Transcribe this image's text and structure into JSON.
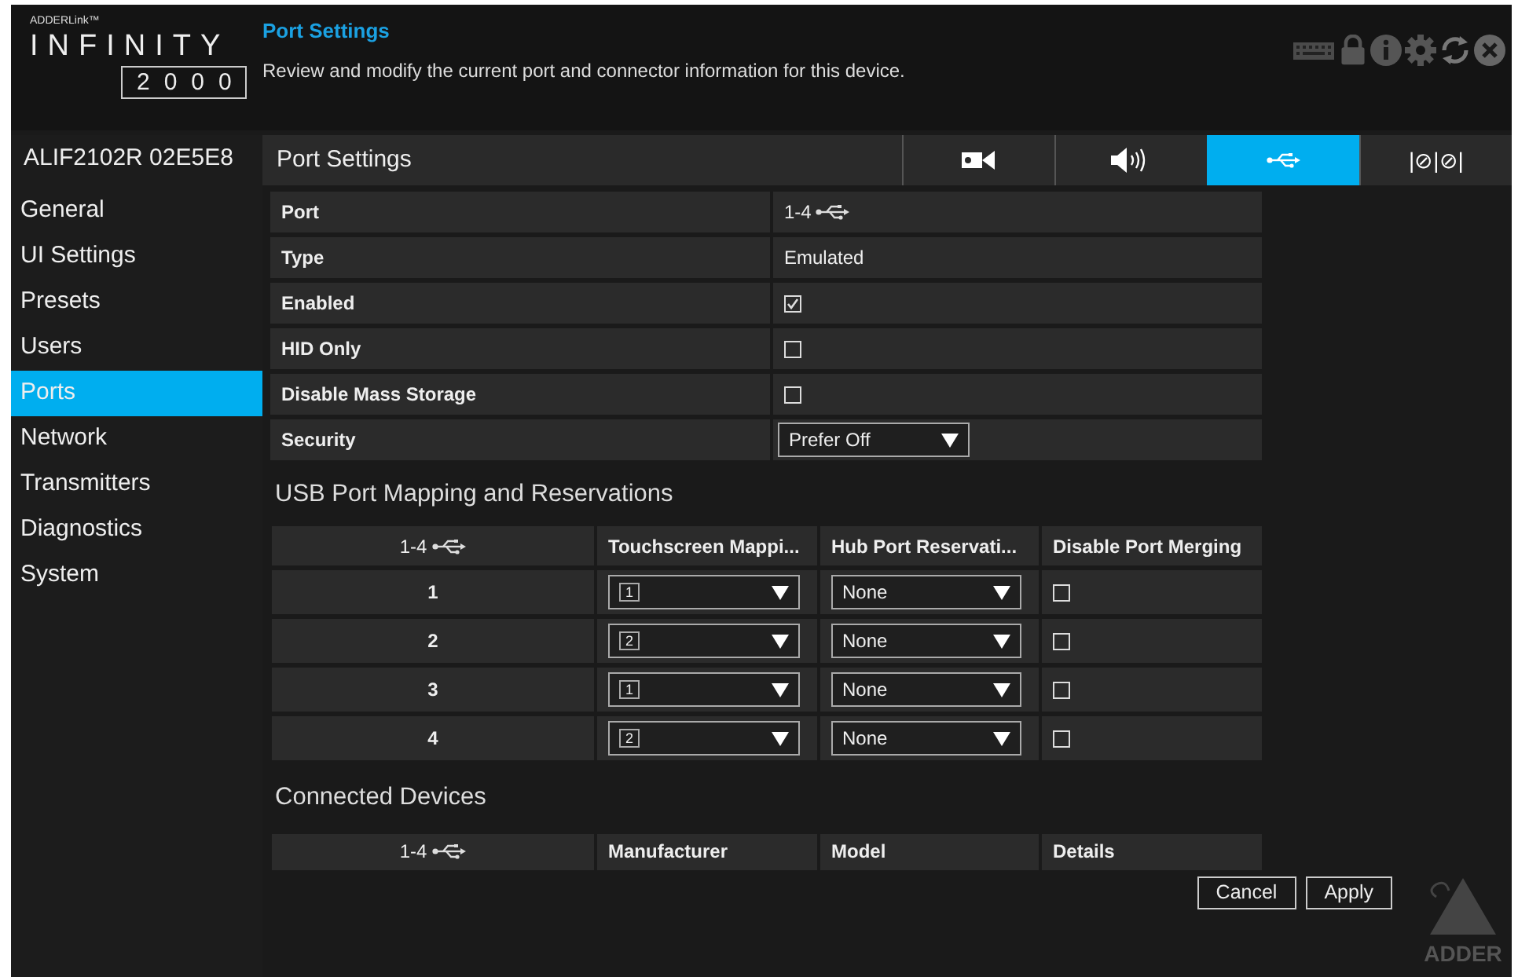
{
  "logo": {
    "brand": "ADDERLink™",
    "product": "INFINITY",
    "model": "2000"
  },
  "header": {
    "title": "Port Settings",
    "description": "Review and modify the current port and connector information for this device."
  },
  "toolbar_icons": [
    {
      "kind": "keyboard"
    },
    {
      "kind": "lock"
    },
    {
      "kind": "info"
    },
    {
      "kind": "settings"
    },
    {
      "kind": "refresh"
    },
    {
      "kind": "close"
    }
  ],
  "device_name": "ALIF2102R 02E5E8",
  "sidebar": {
    "items": [
      {
        "label": "General",
        "selected": false
      },
      {
        "label": "UI Settings",
        "selected": false
      },
      {
        "label": "Presets",
        "selected": false
      },
      {
        "label": "Users",
        "selected": false
      },
      {
        "label": "Ports",
        "selected": true
      },
      {
        "label": "Network",
        "selected": false
      },
      {
        "label": "Transmitters",
        "selected": false
      },
      {
        "label": "Diagnostics",
        "selected": false
      },
      {
        "label": "System",
        "selected": false
      }
    ]
  },
  "panel": {
    "title": "Port Settings",
    "tabs": [
      {
        "kind": "video",
        "selected": false
      },
      {
        "kind": "audio",
        "selected": false
      },
      {
        "kind": "usb",
        "selected": true
      },
      {
        "kind": "serial",
        "label": "|⊘|⊘|",
        "selected": false
      }
    ]
  },
  "settings": [
    {
      "label": "Port",
      "kind": "port",
      "value": "1-4"
    },
    {
      "label": "Type",
      "kind": "text",
      "value": "Emulated"
    },
    {
      "label": "Enabled",
      "kind": "checkbox",
      "checked": true
    },
    {
      "label": "HID Only",
      "kind": "checkbox",
      "checked": false
    },
    {
      "label": "Disable Mass Storage",
      "kind": "checkbox",
      "checked": false
    },
    {
      "label": "Security",
      "kind": "select",
      "value": "Prefer Off"
    }
  ],
  "mapping": {
    "title": "USB Port Mapping and Reservations",
    "columns": [
      "1-4",
      "Touchscreen Mappi...",
      "Hub Port Reservati...",
      "Disable Port Merging"
    ],
    "rows": [
      {
        "port": "1",
        "screen": "1",
        "reservation": "None",
        "disable_merging": false
      },
      {
        "port": "2",
        "screen": "2",
        "reservation": "None",
        "disable_merging": false
      },
      {
        "port": "3",
        "screen": "1",
        "reservation": "None",
        "disable_merging": false
      },
      {
        "port": "4",
        "screen": "2",
        "reservation": "None",
        "disable_merging": false
      }
    ]
  },
  "devices": {
    "title": "Connected Devices",
    "columns": [
      "1-4",
      "Manufacturer",
      "Model",
      "Details"
    ]
  },
  "buttons": [
    "Cancel",
    "Apply"
  ],
  "footer_logo": {
    "text": "ADDER"
  }
}
